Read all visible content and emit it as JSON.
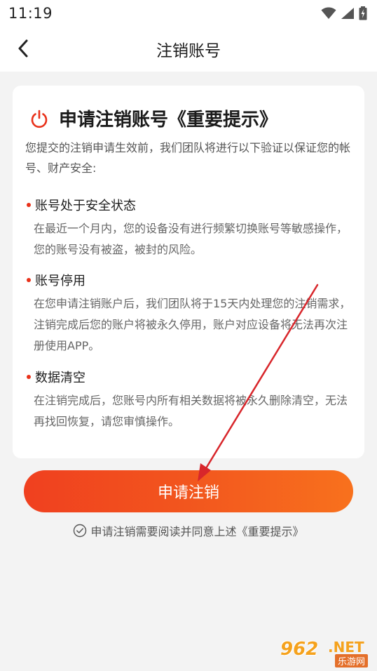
{
  "status_bar": {
    "time": "11:19",
    "icons": [
      "wifi-icon",
      "signal-icon",
      "battery-icon"
    ]
  },
  "nav": {
    "back_icon": "chevron-left-icon",
    "title": "注销账号"
  },
  "card": {
    "title": "申请注销账号《重要提示》",
    "title_icon": "power-icon",
    "intro": "您提交的注销申请生效前，我们团队将进行以下验证以保证您的帐号、财产安全:",
    "sections": [
      {
        "heading": "账号处于安全状态",
        "text": "在最近一个月内，您的设备没有进行频繁切换账号等敏感操作，您的账号没有被盗，被封的风险。"
      },
      {
        "heading": "账号停用",
        "text": "在您申请注销账户后，我们团队将于15天内处理您的注销需求，注销完成后您的账户将被永久停用，账户对应设备将无法再次注册使用APP。"
      },
      {
        "heading": "数据清空",
        "text": "在注销完成后，您账号内所有相关数据将被永久删除清空，无法再找回恢复，请您审慎操作。"
      }
    ]
  },
  "submit_button": {
    "label": "申请注销"
  },
  "agreement": {
    "icon": "check-circle-icon",
    "text": "申请注销需要阅读并同意上述《重要提示》"
  },
  "watermark": {
    "logo": "962",
    "net": ".NET",
    "sub": "乐游网"
  },
  "colors": {
    "accent": "#f0401f",
    "accent_end": "#f8711d",
    "bullet": "#e9311a",
    "annotation_arrow": "#d8262b"
  }
}
